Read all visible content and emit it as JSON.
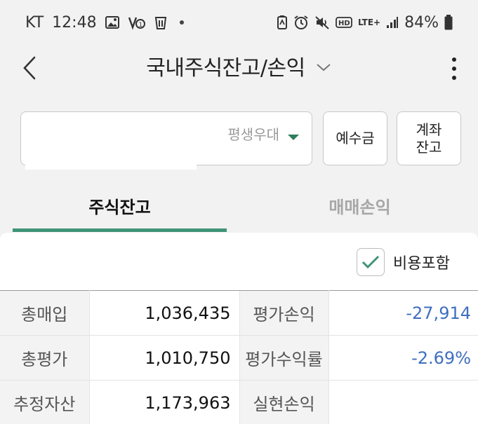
{
  "status_bar": {
    "carrier": "KT",
    "time": "12:48",
    "network": "LTE+",
    "battery": "84%",
    "left_icons": [
      "image-icon",
      "volte-icon",
      "trash-icon"
    ],
    "right_icons": [
      "battery-saver-icon",
      "alarm-icon",
      "mute-icon",
      "hd-icon",
      "signal-icon",
      "battery-icon"
    ]
  },
  "header": {
    "title": "국내주식잔고/손익"
  },
  "account": {
    "name": "평생우대"
  },
  "buttons": {
    "deposit": "예수금",
    "account_line1": "계좌",
    "account_line2": "잔고"
  },
  "tabs": [
    {
      "label": "주식잔고",
      "active": true
    },
    {
      "label": "매매손익",
      "active": false
    }
  ],
  "options": {
    "include_fees_label": "비용포함",
    "include_fees_checked": true
  },
  "summary": {
    "rows": [
      {
        "label1": "총매입",
        "value1": "1,036,435",
        "label2": "평가손익",
        "value2": "-27,914"
      },
      {
        "label1": "총평가",
        "value1": "1,010,750",
        "label2": "평가수익률",
        "value2": "-2.69%"
      },
      {
        "label1": "추정자산",
        "value1": "1,173,963",
        "label2": "실현손익",
        "value2": ""
      }
    ]
  },
  "colors": {
    "accent": "#3e9476",
    "negative": "#3f6fbf",
    "background": "#f2f2f2"
  }
}
